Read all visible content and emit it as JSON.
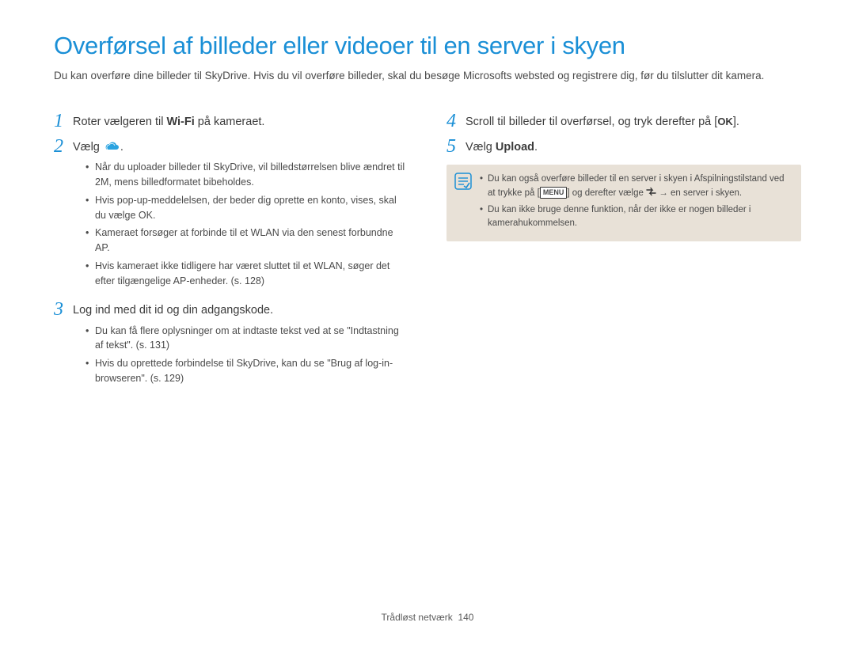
{
  "title": "Overførsel af billeder eller videoer til en server i skyen",
  "intro": "Du kan overføre dine billeder til SkyDrive. Hvis du vil overføre billeder, skal du besøge Microsofts websted og registrere dig, før du tilslutter dit kamera.",
  "left": {
    "step1": {
      "num": "1",
      "text_before": "Roter vælgeren til ",
      "wifi": "Wi-Fi",
      "text_after": " på kameraet."
    },
    "step2": {
      "num": "2",
      "text": "Vælg ",
      "suffix": ".",
      "bullets": [
        "Når du uploader billeder til SkyDrive, vil billedstørrelsen blive ændret til 2M, mens billedformatet bibeholdes.",
        "Hvis pop-up-meddelelsen, der beder dig oprette en konto, vises, skal du vælge OK.",
        "Kameraet forsøger at forbinde til et WLAN via den senest forbundne AP.",
        "Hvis kameraet ikke tidligere har været sluttet til et WLAN, søger det efter tilgængelige AP-enheder. (s. 128)"
      ]
    },
    "step3": {
      "num": "3",
      "text": "Log ind med dit id og din adgangskode.",
      "bullets": [
        "Du kan få flere oplysninger om at indtaste tekst ved at se \"Indtastning af tekst\". (s. 131)",
        "Hvis du oprettede forbindelse til SkyDrive, kan du se \"Brug af log-in-browseren\". (s. 129)"
      ]
    }
  },
  "right": {
    "step4": {
      "num": "4",
      "text_before": "Scroll til billeder til overførsel, og tryk derefter på [",
      "ok": "OK",
      "text_after": "]."
    },
    "step5": {
      "num": "5",
      "text_before": "Vælg ",
      "upload": "Upload",
      "text_after": "."
    },
    "note": {
      "item1_a": "Du kan også overføre billeder til en server i skyen i Afspilningstilstand ved at trykke på [",
      "item1_menu": "MENU",
      "item1_b": "] og derefter vælge ",
      "item1_c": " → en server i skyen.",
      "item2": "Du kan ikke bruge denne funktion, når der ikke er nogen billeder i kamerahukommelsen."
    }
  },
  "footer": {
    "section": "Trådløst netværk",
    "page": "140"
  }
}
